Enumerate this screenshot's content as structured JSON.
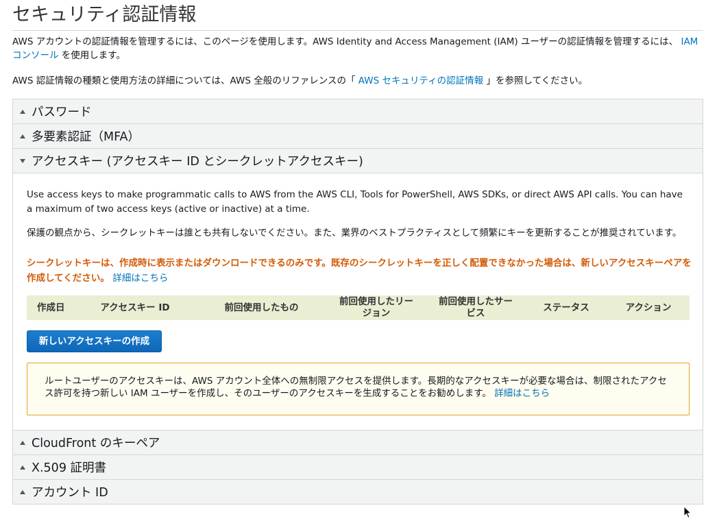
{
  "page": {
    "title": "セキュリティ認証情報",
    "intro_1_text": "AWS アカウントの認証情報を管理するには、このページを使用します。AWS Identity and Access Management (IAM) ユーザーの認証情報を管理するには、",
    "intro_1_link": "IAM コンソール",
    "intro_1_suffix": "を使用します。",
    "intro_2_text": "AWS 認証情報の種類と使用方法の詳細については、AWS 全般のリファレンスの「",
    "intro_2_link": "AWS セキュリティの認証情報",
    "intro_2_suffix": "」を参照してください。"
  },
  "sections": {
    "password": {
      "label": "パスワード",
      "expanded": false
    },
    "mfa": {
      "label": "多要素認証（MFA）",
      "expanded": false
    },
    "access_keys": {
      "label": "アクセスキー (アクセスキー ID とシークレットアクセスキー)",
      "expanded": true
    },
    "cloudfront": {
      "label": "CloudFront のキーペア",
      "expanded": false
    },
    "x509": {
      "label": "X.509 証明書",
      "expanded": false
    },
    "account_id": {
      "label": "アカウント ID",
      "expanded": false
    }
  },
  "access_keys_panel": {
    "description_en": "Use access keys to make programmatic calls to AWS from the AWS CLI, Tools for PowerShell, AWS SDKs, or direct AWS API calls. You can have a maximum of two access keys (active or inactive) at a time.",
    "description_ja": "保護の観点から、シークレットキーは誰とも共有しないでください。また、業界のベストプラクティスとして頻繁にキーを更新することが推奨されています。",
    "warning": "シークレットキーは、作成時に表示またはダウンロードできるのみです。既存のシークレットキーを正しく配置できなかった場合は、新しいアクセスキーペアを作成してください。",
    "warning_link": "詳細はこちら",
    "table_columns": {
      "created": "作成日",
      "key_id": "アクセスキー ID",
      "last_used": "前回使用したもの",
      "last_region": "前回使用したリージョン",
      "last_service": "前回使用したサービス",
      "status": "ステータス",
      "actions": "アクション"
    },
    "create_button": "新しいアクセスキーの作成",
    "notice_text": "ルートユーザーのアクセスキーは、AWS アカウント全体への無制限アクセスを提供します。長期的なアクセスキーが必要な場合は、制限されたアクセス許可を持つ新しい IAM ユーザーを作成し、そのユーザーのアクセスキーを生成することをお勧めします。",
    "notice_link": "詳細はこちら"
  },
  "icons": {
    "collapsed": "caret-up-icon",
    "expanded": "caret-down-icon",
    "pointer": "mouse-pointer-icon"
  },
  "colors": {
    "link": "#0073bb",
    "warning_text": "#d45b07",
    "primary_button": "#1a7fd0",
    "table_header": "#eaeed3",
    "notice_border": "#e1a42c"
  }
}
